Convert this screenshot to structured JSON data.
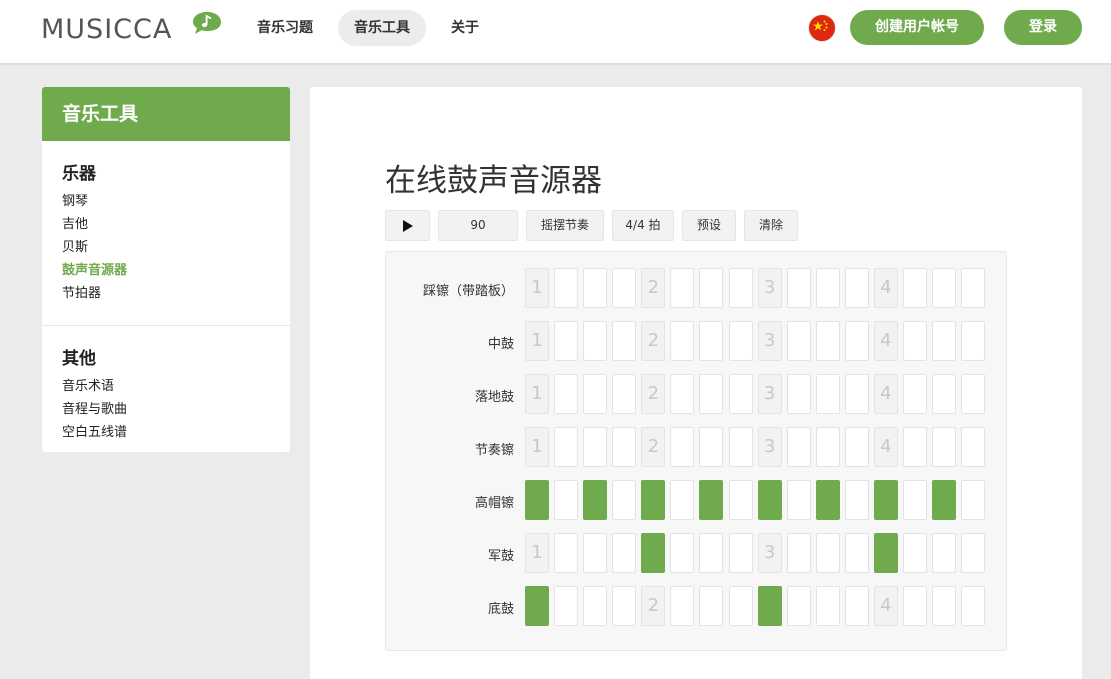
{
  "header": {
    "logo_text": "MUSICCA",
    "nav": [
      {
        "label": "音乐习题",
        "active": false
      },
      {
        "label": "音乐工具",
        "active": true
      },
      {
        "label": "关于",
        "active": false
      }
    ],
    "language_flag_icon": "china-flag-icon",
    "create_account_label": "创建用户帐号",
    "login_label": "登录"
  },
  "sidebar": {
    "title": "音乐工具",
    "sections": [
      {
        "title": "乐器",
        "items": [
          {
            "label": "钢琴",
            "current": false
          },
          {
            "label": "吉他",
            "current": false
          },
          {
            "label": "贝斯",
            "current": false
          },
          {
            "label": "鼓声音源器",
            "current": true
          },
          {
            "label": "节拍器",
            "current": false
          }
        ]
      },
      {
        "title": "其他",
        "items": [
          {
            "label": "音乐术语",
            "current": false
          },
          {
            "label": "音程与歌曲",
            "current": false
          },
          {
            "label": "空白五线谱",
            "current": false
          }
        ]
      }
    ]
  },
  "main": {
    "title": "在线鼓声音源器",
    "toolbar": {
      "play_icon": "play-icon",
      "tempo_value": "90",
      "swing_label": "摇摆节奏",
      "time_signature_label": "4/4 拍",
      "presets_label": "预设",
      "clear_label": "清除"
    },
    "sequencer": {
      "beat_numbers": [
        "1",
        "2",
        "3",
        "4"
      ],
      "rows": [
        {
          "label": "踩镲（带踏板）",
          "steps": [
            0,
            0,
            0,
            0,
            0,
            0,
            0,
            0,
            0,
            0,
            0,
            0,
            0,
            0,
            0,
            0
          ]
        },
        {
          "label": "中鼓",
          "steps": [
            0,
            0,
            0,
            0,
            0,
            0,
            0,
            0,
            0,
            0,
            0,
            0,
            0,
            0,
            0,
            0
          ]
        },
        {
          "label": "落地鼓",
          "steps": [
            0,
            0,
            0,
            0,
            0,
            0,
            0,
            0,
            0,
            0,
            0,
            0,
            0,
            0,
            0,
            0
          ]
        },
        {
          "label": "节奏镲",
          "steps": [
            0,
            0,
            0,
            0,
            0,
            0,
            0,
            0,
            0,
            0,
            0,
            0,
            0,
            0,
            0,
            0
          ]
        },
        {
          "label": "高帽镲",
          "steps": [
            1,
            0,
            1,
            0,
            1,
            0,
            1,
            0,
            1,
            0,
            1,
            0,
            1,
            0,
            1,
            0
          ]
        },
        {
          "label": "军鼓",
          "steps": [
            0,
            0,
            0,
            0,
            1,
            0,
            0,
            0,
            0,
            0,
            0,
            0,
            1,
            0,
            0,
            0
          ]
        },
        {
          "label": "底鼓",
          "steps": [
            1,
            0,
            0,
            0,
            0,
            0,
            0,
            0,
            1,
            0,
            0,
            0,
            0,
            0,
            0,
            0
          ]
        }
      ]
    }
  },
  "colors": {
    "accent": "#6fab4c",
    "background": "#ebebeb"
  }
}
